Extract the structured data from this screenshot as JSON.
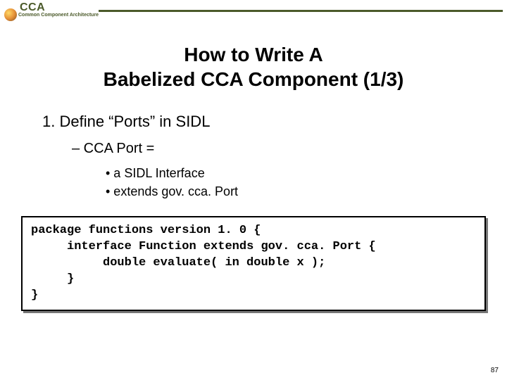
{
  "header": {
    "acronym": "CCA",
    "subtitle": "Common Component Architecture"
  },
  "title_line1": "How to Write A",
  "title_line2": "Babelized CCA Component (1/3)",
  "outline": {
    "item1": "1.  Define “Ports” in SIDL",
    "item2": "–   CCA Port =",
    "bullet1": "•    a SIDL Interface",
    "bullet2": "•    extends gov. cca. Port"
  },
  "code": {
    "l1a": "package",
    "l1b": " functions ",
    "l1c": "version",
    "l1d": " 1. 0 {",
    "l2a": "     interface",
    "l2b": " Function ",
    "l2c": "extends",
    "l2d": " gov. cca. Port {",
    "l3a": "          double",
    "l3b": " evaluate( ",
    "l3c": "in double",
    "l3d": " x );",
    "l4": "     }",
    "l5": "}"
  },
  "page_number": "87"
}
